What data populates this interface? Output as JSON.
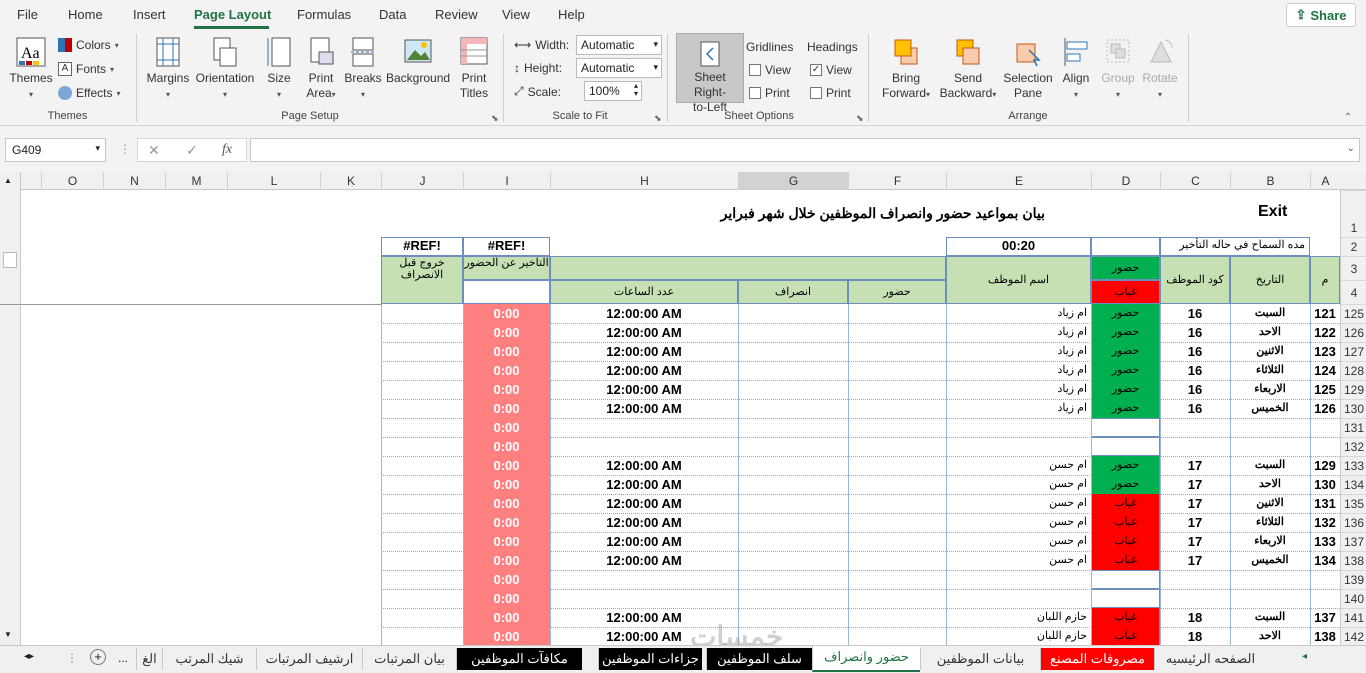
{
  "menu": {
    "tabs": [
      "File",
      "Home",
      "Insert",
      "Page Layout",
      "Formulas",
      "Data",
      "Review",
      "View",
      "Help"
    ],
    "active": "Page Layout",
    "share": "Share"
  },
  "ribbon": {
    "themes": {
      "themes": "Themes",
      "colors": "Colors",
      "fonts": "Fonts",
      "effects": "Effects",
      "group": "Themes"
    },
    "page_setup": {
      "margins": "Margins",
      "orientation": "Orientation",
      "size": "Size",
      "print_area_1": "Print",
      "print_area_2": "Area",
      "breaks": "Breaks",
      "background": "Background",
      "print_titles_1": "Print",
      "print_titles_2": "Titles",
      "group": "Page Setup"
    },
    "scale_to_fit": {
      "width_label": "Width:",
      "width_value": "Automatic",
      "height_label": "Height:",
      "height_value": "Automatic",
      "scale_label": "Scale:",
      "scale_value": "100%",
      "group": "Scale to Fit"
    },
    "sheet_options": {
      "rtl_1": "Sheet Right-",
      "rtl_2": "to-Left",
      "gridlines": "Gridlines",
      "headings": "Headings",
      "view": "View",
      "print": "Print",
      "group": "Sheet Options"
    },
    "arrange": {
      "bring_1": "Bring",
      "bring_2": "Forward",
      "send_1": "Send",
      "send_2": "Backward",
      "selection_1": "Selection",
      "selection_2": "Pane",
      "align": "Align",
      "group_btn": "Group",
      "rotate": "Rotate",
      "group": "Arrange"
    }
  },
  "formula_bar": {
    "name_box": "G409",
    "fx": "fx",
    "formula": ""
  },
  "columns": [
    "O",
    "N",
    "M",
    "L",
    "K",
    "J",
    "I",
    "H",
    "G",
    "F",
    "E",
    "D",
    "C",
    "B",
    "A"
  ],
  "sheet": {
    "exit": "Exit",
    "title": "بيان بمواعيد حضور وانصراف الموظفين خلال شهر فبراير",
    "grace_label": "مده السماح في حاله التأخير",
    "grace_value": "00:20",
    "ref1": "#REF!",
    "ref2": "#REF!",
    "headers": {
      "m": "م",
      "date": "التاريخ",
      "code": "كود الموظف",
      "present": "حضور",
      "absent": "غياب",
      "name": "اسم الموظف",
      "attend": "حضور",
      "leave": "انصراف",
      "hours": "عدد الساعات",
      "late": "التاخير عن الحضور",
      "early": "خروج قبل الانصراف"
    },
    "rows": [
      {
        "rn": "125",
        "m": "121",
        "day": "السبت",
        "code": "16",
        "status": "حضور",
        "st": "green",
        "name": "ام زياد",
        "hours": "12:00:00 AM",
        "late": "0:00"
      },
      {
        "rn": "126",
        "m": "122",
        "day": "الاحد",
        "code": "16",
        "status": "حضور",
        "st": "green",
        "name": "ام زياد",
        "hours": "12:00:00 AM",
        "late": "0:00"
      },
      {
        "rn": "127",
        "m": "123",
        "day": "الاثنين",
        "code": "16",
        "status": "حضور",
        "st": "green",
        "name": "ام زياد",
        "hours": "12:00:00 AM",
        "late": "0:00"
      },
      {
        "rn": "128",
        "m": "124",
        "day": "الثلاثاء",
        "code": "16",
        "status": "حضور",
        "st": "green",
        "name": "ام زياد",
        "hours": "12:00:00 AM",
        "late": "0:00"
      },
      {
        "rn": "129",
        "m": "125",
        "day": "الاربعاء",
        "code": "16",
        "status": "حضور",
        "st": "green",
        "name": "ام زياد",
        "hours": "12:00:00 AM",
        "late": "0:00"
      },
      {
        "rn": "130",
        "m": "126",
        "day": "الخميس",
        "code": "16",
        "status": "حضور",
        "st": "green",
        "name": "ام زياد",
        "hours": "12:00:00 AM",
        "late": "0:00"
      },
      {
        "rn": "131",
        "m": "",
        "day": "",
        "code": "",
        "status": "",
        "st": "",
        "name": "",
        "hours": "",
        "late": "0:00"
      },
      {
        "rn": "132",
        "m": "",
        "day": "",
        "code": "",
        "status": "",
        "st": "",
        "name": "",
        "hours": "",
        "late": "0:00"
      },
      {
        "rn": "133",
        "m": "129",
        "day": "السبت",
        "code": "17",
        "status": "حضور",
        "st": "green",
        "name": "ام حسن",
        "hours": "12:00:00 AM",
        "late": "0:00"
      },
      {
        "rn": "134",
        "m": "130",
        "day": "الاحد",
        "code": "17",
        "status": "حضور",
        "st": "green",
        "name": "ام حسن",
        "hours": "12:00:00 AM",
        "late": "0:00"
      },
      {
        "rn": "135",
        "m": "131",
        "day": "الاثنين",
        "code": "17",
        "status": "غياب",
        "st": "red",
        "name": "ام حسن",
        "hours": "12:00:00 AM",
        "late": "0:00"
      },
      {
        "rn": "136",
        "m": "132",
        "day": "الثلاثاء",
        "code": "17",
        "status": "غياب",
        "st": "red",
        "name": "ام حسن",
        "hours": "12:00:00 AM",
        "late": "0:00"
      },
      {
        "rn": "137",
        "m": "133",
        "day": "الاربعاء",
        "code": "17",
        "status": "غياب",
        "st": "red",
        "name": "ام حسن",
        "hours": "12:00:00 AM",
        "late": "0:00"
      },
      {
        "rn": "138",
        "m": "134",
        "day": "الخميس",
        "code": "17",
        "status": "غياب",
        "st": "red",
        "name": "ام حسن",
        "hours": "12:00:00 AM",
        "late": "0:00"
      },
      {
        "rn": "139",
        "m": "",
        "day": "",
        "code": "",
        "status": "",
        "st": "",
        "name": "",
        "hours": "",
        "late": "0:00"
      },
      {
        "rn": "140",
        "m": "",
        "day": "",
        "code": "",
        "status": "",
        "st": "",
        "name": "",
        "hours": "",
        "late": "0:00"
      },
      {
        "rn": "141",
        "m": "137",
        "day": "السبت",
        "code": "18",
        "status": "غياب",
        "st": "red",
        "name": "حازم اللبان",
        "hours": "12:00:00 AM",
        "late": "0:00"
      },
      {
        "rn": "142",
        "m": "138",
        "day": "الاحد",
        "code": "18",
        "status": "غياب",
        "st": "red",
        "name": "حازم اللبان",
        "hours": "12:00:00 AM",
        "late": "0:00"
      }
    ]
  },
  "sheet_tabs": [
    "الصفحه الرئيسيه",
    "مصروفات المصنع",
    "بيانات الموظفين",
    "حضور وانصراف",
    "سلف الموظفين",
    "جزاءات الموظفين",
    "مكافآت الموظفين",
    "بيان المرتبات",
    "ارشيف المرتبات",
    "شيك المرتب",
    "الغ"
  ],
  "tabs_more": "...",
  "watermark": "خمسات"
}
